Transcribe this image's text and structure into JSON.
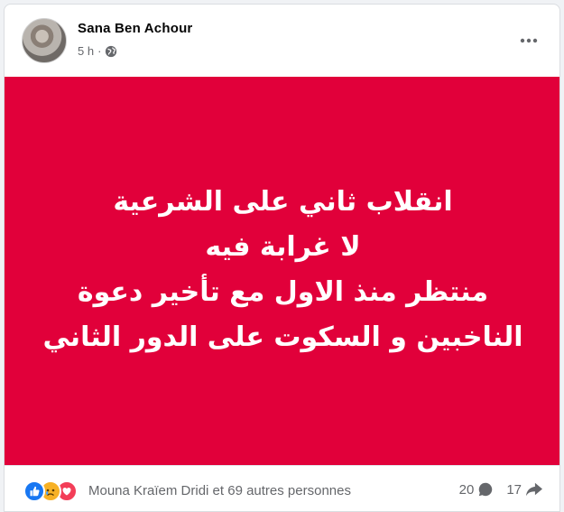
{
  "post": {
    "author": "Sana Ben Achour",
    "time": "5 h",
    "separator": "·",
    "privacy_icon": "globe-icon",
    "more_icon": "more-dots-icon",
    "banner_color": "#e1003a",
    "text_lines": [
      "انقلاب ثاني على الشرعية",
      "لا غرابة فيه",
      "منتظر منذ الاول مع تأخير دعوة",
      "الناخبين و السكوت على الدور الثاني"
    ]
  },
  "footer": {
    "reaction_icons": [
      "like-icon",
      "sad-icon",
      "love-icon"
    ],
    "reactions_text": "Mouna Kraïem Dridi et 69 autres personnes",
    "comments_count": "20",
    "comments_icon": "comment-icon",
    "shares_count": "17",
    "shares_icon": "share-icon"
  }
}
